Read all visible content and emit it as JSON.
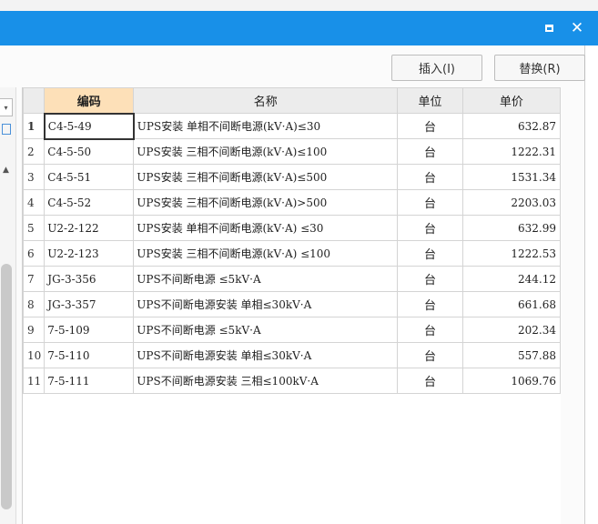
{
  "window": {
    "maximize_icon": "maximize-icon",
    "close_icon": "close-icon",
    "close_glyph": "✕"
  },
  "toolbar": {
    "insert_label": "插入(I)",
    "replace_label": "替换(R)"
  },
  "table": {
    "headers": {
      "code": "编码",
      "name": "名称",
      "unit": "单位",
      "price": "单价"
    },
    "rows": [
      {
        "num": "1",
        "code": "C4-5-49",
        "name": "UPS安装 单相不间断电源(kV·A)≤30",
        "unit": "台",
        "price": "632.87"
      },
      {
        "num": "2",
        "code": "C4-5-50",
        "name": "UPS安装 三相不间断电源(kV·A)≤100",
        "unit": "台",
        "price": "1222.31"
      },
      {
        "num": "3",
        "code": "C4-5-51",
        "name": "UPS安装 三相不间断电源(kV·A)≤500",
        "unit": "台",
        "price": "1531.34"
      },
      {
        "num": "4",
        "code": "C4-5-52",
        "name": "UPS安装 三相不间断电源(kV·A)>500",
        "unit": "台",
        "price": "2203.03"
      },
      {
        "num": "5",
        "code": "U2-2-122",
        "name": "UPS安装 单相不间断电源(kV·A) ≤30",
        "unit": "台",
        "price": "632.99"
      },
      {
        "num": "6",
        "code": "U2-2-123",
        "name": "UPS安装 三相不间断电源(kV·A) ≤100",
        "unit": "台",
        "price": "1222.53"
      },
      {
        "num": "7",
        "code": "JG-3-356",
        "name": "UPS不间断电源 ≤5kV·A",
        "unit": "台",
        "price": "244.12"
      },
      {
        "num": "8",
        "code": "JG-3-357",
        "name": "UPS不间断电源安装 单相≤30kV·A",
        "unit": "台",
        "price": "661.68"
      },
      {
        "num": "9",
        "code": "7-5-109",
        "name": "UPS不间断电源 ≤5kV·A",
        "unit": "台",
        "price": "202.34"
      },
      {
        "num": "10",
        "code": "7-5-110",
        "name": "UPS不间断电源安装 单相≤30kV·A",
        "unit": "台",
        "price": "557.88"
      },
      {
        "num": "11",
        "code": "7-5-111",
        "name": "UPS不间断电源安装 三相≤100kV·A",
        "unit": "台",
        "price": "1069.76"
      }
    ]
  },
  "colors": {
    "titlebar": "#1890e8",
    "code_header_highlight": "#fde0b8"
  }
}
